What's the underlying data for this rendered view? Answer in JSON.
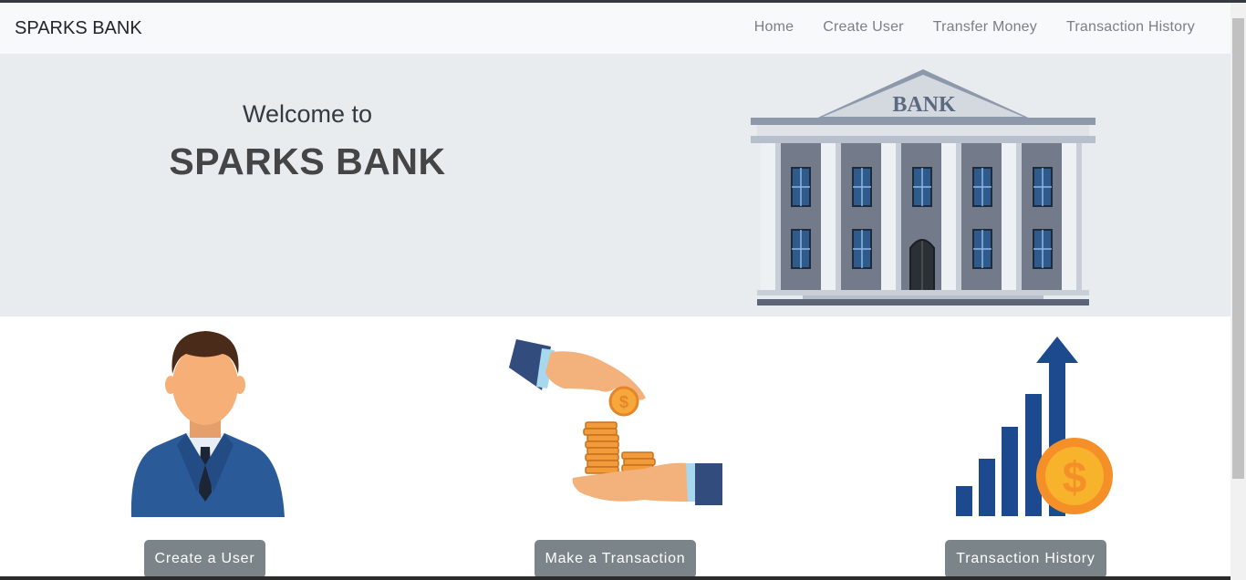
{
  "navbar": {
    "brand": "SPARKS BANK",
    "links": [
      {
        "label": "Home"
      },
      {
        "label": "Create User"
      },
      {
        "label": "Transfer Money"
      },
      {
        "label": "Transaction History"
      }
    ]
  },
  "hero": {
    "welcome": "Welcome to",
    "title": "SPARKS BANK",
    "bank_sign": "BANK"
  },
  "features": [
    {
      "button": "Create a User",
      "icon": "businessman-icon"
    },
    {
      "button": "Make a Transaction",
      "icon": "hands-coins-icon"
    },
    {
      "button": "Transaction History",
      "icon": "growth-chart-icon"
    }
  ],
  "colors": {
    "navbar_bg": "#f8f9fa",
    "hero_bg": "#e9ecef",
    "button_bg": "#7b8489"
  }
}
